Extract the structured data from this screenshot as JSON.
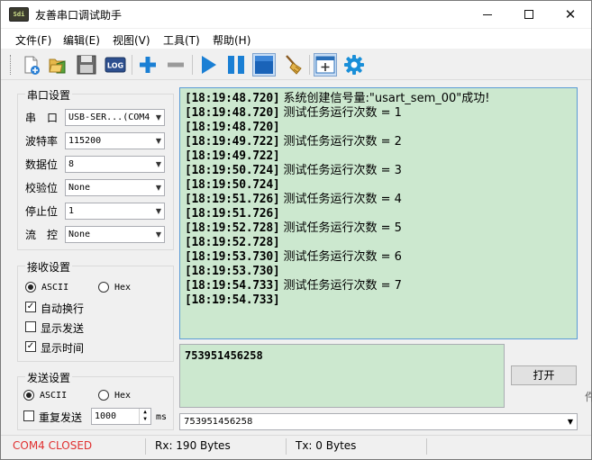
{
  "window": {
    "title": "友善串口调试助手",
    "icon_text": "Sdi"
  },
  "menu": {
    "file": "文件(F)",
    "edit": "编辑(E)",
    "view": "视图(V)",
    "tools": "工具(T)",
    "help": "帮助(H)"
  },
  "toolbar": {
    "log_label": "LOG",
    "icons": [
      "new-icon",
      "open-folder-icon",
      "save-icon",
      "log-icon",
      "plus-icon",
      "minus-icon",
      "play-icon",
      "pause-icon",
      "stop-icon",
      "clear-broom-icon",
      "window-add-icon",
      "gear-icon"
    ]
  },
  "serial": {
    "title": "串口设置",
    "port_label": "串　口",
    "port_value": "USB-SER...(COM4",
    "baud_label": "波特率",
    "baud_value": "115200",
    "data_label": "数据位",
    "data_value": "8",
    "parity_label": "校验位",
    "parity_value": "None",
    "stop_label": "停止位",
    "stop_value": "1",
    "flow_label": "流　控",
    "flow_value": "None"
  },
  "receive": {
    "title": "接收设置",
    "ascii_label": "ASCII",
    "hex_label": "Hex",
    "mode_selected": "ASCII",
    "auto_newline_label": "自动换行",
    "auto_newline": true,
    "show_send_label": "显示发送",
    "show_send": false,
    "show_time_label": "显示时间",
    "show_time": true
  },
  "send": {
    "title": "发送设置",
    "ascii_label": "ASCII",
    "hex_label": "Hex",
    "mode_selected": "ASCII",
    "repeat_label": "重复发送",
    "repeat": false,
    "interval_value": "1000",
    "interval_unit": "ms"
  },
  "log": [
    {
      "ts": "[18:19:48.720]",
      "msg": "系统创建信号量:\"usart_sem_00\"成功!"
    },
    {
      "ts": "[18:19:48.720]",
      "msg": "测试任务运行次数 = 1"
    },
    {
      "ts": "[18:19:48.720]",
      "msg": ""
    },
    {
      "ts": "[18:19:49.722]",
      "msg": "测试任务运行次数 = 2"
    },
    {
      "ts": "[18:19:49.722]",
      "msg": ""
    },
    {
      "ts": "[18:19:50.724]",
      "msg": "测试任务运行次数 = 3"
    },
    {
      "ts": "[18:19:50.724]",
      "msg": ""
    },
    {
      "ts": "[18:19:51.726]",
      "msg": "测试任务运行次数 = 4"
    },
    {
      "ts": "[18:19:51.726]",
      "msg": ""
    },
    {
      "ts": "[18:19:52.728]",
      "msg": "测试任务运行次数 = 5"
    },
    {
      "ts": "[18:19:52.728]",
      "msg": ""
    },
    {
      "ts": "[18:19:53.730]",
      "msg": "测试任务运行次数 = 6"
    },
    {
      "ts": "[18:19:53.730]",
      "msg": ""
    },
    {
      "ts": "[18:19:54.733]",
      "msg": "测试任务运行次数 = 7"
    },
    {
      "ts": "[18:19:54.733]",
      "msg": ""
    }
  ],
  "send_box": {
    "text": "753951456258",
    "open_button": "打开",
    "history_value": "753951456258"
  },
  "status": {
    "port_state": "COM4 CLOSED",
    "rx": "Rx: 190 Bytes",
    "tx": "Tx: 0 Bytes"
  },
  "colors": {
    "recv_bg": "#cce8cf",
    "recv_border": "#5b9bd5",
    "status_error": "#e03030",
    "toolbar_blue": "#1a7fd4"
  }
}
